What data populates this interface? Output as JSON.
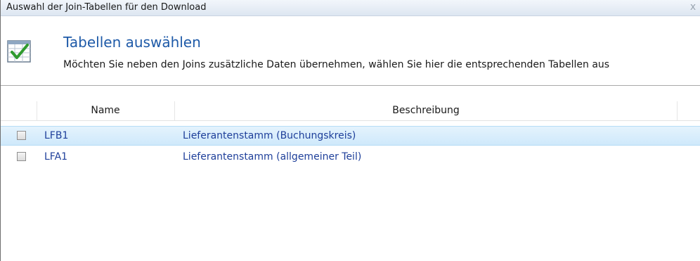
{
  "window": {
    "title": "Auswahl der Join-Tabellen für den Download",
    "close_glyph": "x"
  },
  "header": {
    "icon": "checkmark-grid-icon",
    "title": "Tabellen auswählen",
    "subtitle": "Möchten Sie neben den Joins zusätzliche Daten übernehmen, wählen Sie hier die entsprechenden Tabellen aus"
  },
  "table": {
    "columns": {
      "name": "Name",
      "description": "Beschreibung"
    },
    "rows": [
      {
        "name": "LFB1",
        "description": "Lieferantenstamm (Buchungskreis)",
        "checked": false,
        "selected": true
      },
      {
        "name": "LFA1",
        "description": "Lieferantenstamm (allgemeiner Teil)",
        "checked": false,
        "selected": false
      }
    ]
  },
  "colors": {
    "title_accent": "#1e5aa8",
    "row_text": "#1e3f9a",
    "selection": "#cfe9fb"
  }
}
